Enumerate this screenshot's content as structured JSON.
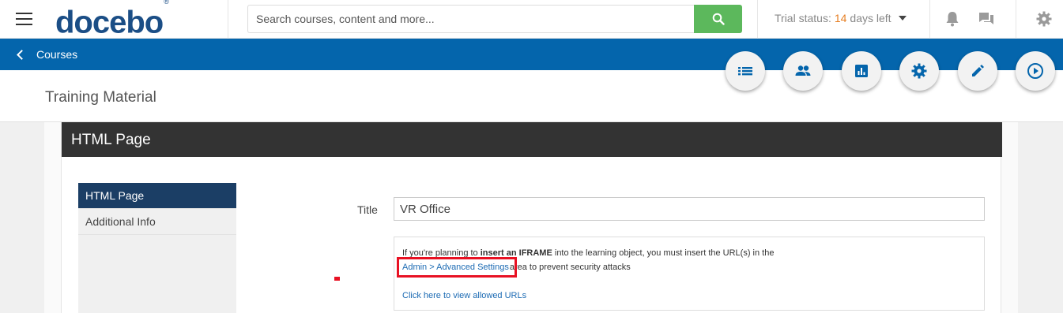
{
  "header": {
    "logo_text": "docebo",
    "logo_mark": "®",
    "search_placeholder": "Search courses, content and more...",
    "trial_prefix": "Trial status:",
    "trial_days": "14",
    "trial_suffix": "days left"
  },
  "nav": {
    "back_label": "Courses"
  },
  "page": {
    "title": "Training Material"
  },
  "actions": [
    {
      "icon": "list-icon"
    },
    {
      "icon": "users-icon"
    },
    {
      "icon": "report-icon"
    },
    {
      "icon": "gear-icon"
    },
    {
      "icon": "pencil-icon"
    },
    {
      "icon": "play-icon"
    }
  ],
  "panel": {
    "header": "HTML Page",
    "tabs": [
      {
        "label": "HTML Page",
        "active": true
      },
      {
        "label": "Additional Info",
        "active": false
      }
    ],
    "form": {
      "title_label": "Title",
      "title_value": "VR Office"
    },
    "info": {
      "line1_pre": "If you're planning to",
      "line1_bold": "insert an IFRAME",
      "line1_post": "into the learning object, you must insert the URL(s) in the",
      "link_text": "Admin > Advanced Settings",
      "line2_post": "area to prevent security attacks",
      "allowed_urls_link": "Click here to view allowed URLs"
    }
  },
  "colors": {
    "brand_blue": "#0465ac",
    "logo_blue": "#1b4e86",
    "search_green": "#5cb85c",
    "trial_orange": "#e67e22",
    "dark_header": "#333333",
    "active_tab": "#1b3e65",
    "highlight_red": "#e81123"
  }
}
